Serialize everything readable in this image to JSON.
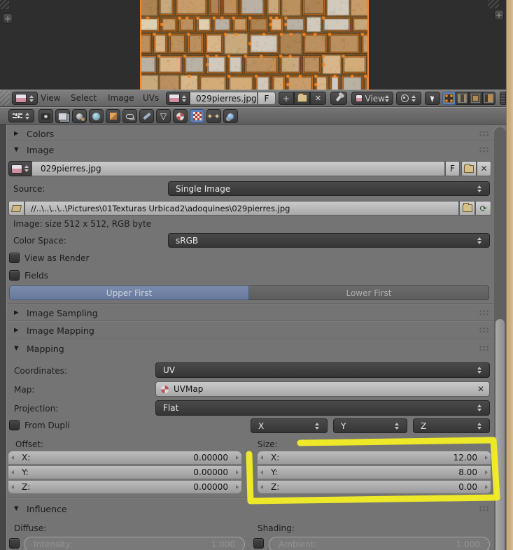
{
  "uv_editor": {
    "menus": [
      "View",
      "Select",
      "Image",
      "UVs"
    ],
    "image_name": "029pierres.jpg",
    "fake_user_label": "F",
    "new_image_label": "+",
    "view_dropdown_label": "View",
    "expand_region_left": "+",
    "expand_region_right": "+"
  },
  "props_header": {
    "icons": [
      "render-icon",
      "render-layers-icon",
      "scene-icon",
      "world-icon",
      "object-icon",
      "constraints-icon",
      "modifiers-icon",
      "object-data-icon",
      "material-icon",
      "texture-icon",
      "particles-icon",
      "physics-icon"
    ],
    "active_tab": "texture"
  },
  "panels": {
    "colors": {
      "title": "Colors"
    },
    "image": {
      "title": "Image",
      "datablock_name": "029pierres.jpg",
      "fake_user_label": "F",
      "source_label": "Source:",
      "source_value": "Single Image",
      "filepath": "//..\\..\\..\\..\\Pictures\\01Texturas Urbicad2\\adoquines\\029pierres.jpg",
      "info": "Image: size 512 x 512, RGB byte",
      "color_space_label": "Color Space:",
      "color_space_value": "sRGB",
      "view_as_render_label": "View as Render",
      "fields_label": "Fields",
      "upper_first_label": "Upper First",
      "lower_first_label": "Lower First"
    },
    "image_sampling": {
      "title": "Image Sampling"
    },
    "image_mapping": {
      "title": "Image Mapping"
    },
    "mapping": {
      "title": "Mapping",
      "coordinates_label": "Coordinates:",
      "coordinates_value": "UV",
      "map_label": "Map:",
      "map_value": "UVMap",
      "projection_label": "Projection:",
      "projection_value": "Flat",
      "from_dupli_label": "From Dupli",
      "axis_options": [
        "X",
        "Y",
        "Z"
      ],
      "offset_label": "Offset:",
      "size_label": "Size:",
      "offset_rows": [
        {
          "label": "X:",
          "value": "0.00000"
        },
        {
          "label": "Y:",
          "value": "0.00000"
        },
        {
          "label": "Z:",
          "value": "0.00000"
        }
      ],
      "size_rows": [
        {
          "label": "X:",
          "value": "12.00"
        },
        {
          "label": "Y:",
          "value": "8.00"
        },
        {
          "label": "Z:",
          "value": "0.00"
        }
      ]
    },
    "influence": {
      "title": "Influence",
      "diffuse_label": "Diffuse:",
      "shading_label": "Shading:",
      "intensity_label": "Intensity:",
      "intensity_value": "1.000",
      "ambient_label": "Ambient:",
      "ambient_value": "1.000"
    }
  },
  "colors": {
    "annotation_yellow": "#f2ee25",
    "uv_overlay_orange": "#f5861f",
    "active_button_blue": "#5c7fb7",
    "panel_bg": "#747474",
    "grout": "#74572f",
    "texture_palette": [
      "#c79c69",
      "#d2ab76",
      "#bb905e",
      "#d9b68a",
      "#c8a97c",
      "#d0c9bc",
      "#b9b1a4",
      "#e0cfae",
      "#ad8352"
    ]
  }
}
